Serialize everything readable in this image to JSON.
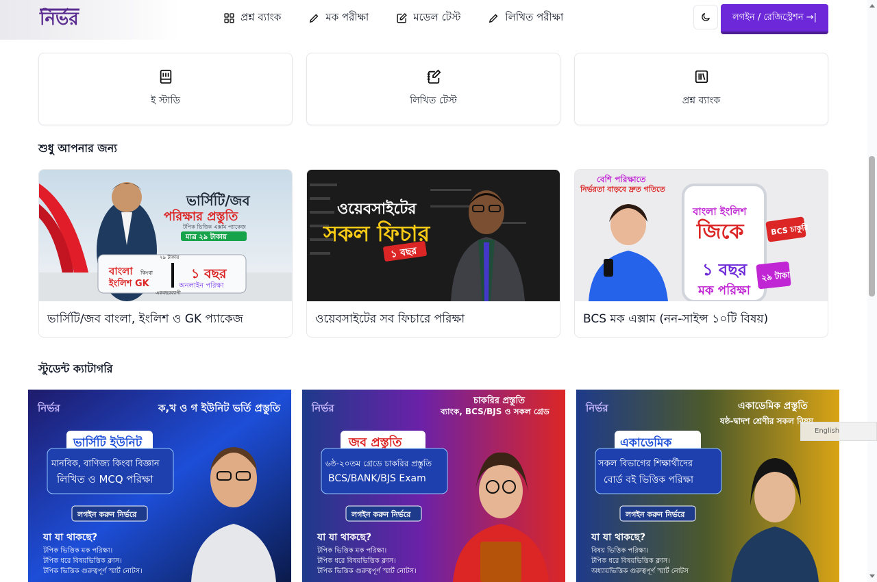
{
  "header": {
    "logo_text": "নির্ভর",
    "nav": [
      {
        "label": "প্রশ্ন ব্যাংক",
        "icon": "grid-icon"
      },
      {
        "label": "মক পরীক্ষা",
        "icon": "pencil-icon"
      },
      {
        "label": "মডেল টেস্ট",
        "icon": "edit-square-icon"
      },
      {
        "label": "লিখিত পরীক্ষা",
        "icon": "pencil-icon"
      }
    ],
    "theme_toggle_icon": "moon-icon",
    "login_label": "লগইন / রেজিস্ট্রেশন →|"
  },
  "categories": [
    {
      "label": "ই স্টাডি",
      "icon": "book-icon"
    },
    {
      "label": "লিখিত টেস্ট",
      "icon": "notebook-pen-icon"
    },
    {
      "label": "প্রশ্ন ব্যাংক",
      "icon": "library-icon"
    }
  ],
  "sections": {
    "for_you": "শুধু আপনার জন্য",
    "student_category": "স্টুডেন্ট ক্যাটাগরি"
  },
  "products": [
    {
      "title": "ভার্সিটি/জব বাংলা, ইংলিশ ও GK প্যাকেজ",
      "img_headline": "ভার্সিটি/জব",
      "img_sub": "পরিক্ষার প্রস্তুতি",
      "img_small": "টপিক ভিত্তিক এক্সাম প্যাকেজ",
      "img_price": "মাত্র ২৯ টাকায়",
      "img_box_left": "বাংলা",
      "img_box_left2": "কিংবা",
      "img_box_left3": "ইংলিশ GK",
      "img_box_right": "১ বছর",
      "img_box_right2": "অনলাইন পরিক্ষা",
      "img_price_tag": "২৯ টাকায়",
      "img_yearly": "একবছরব্যাপী"
    },
    {
      "title": "ওয়েবসাইটের সব ফিচারে পরিক্ষা",
      "img_line1": "ওয়েবসাইটের",
      "img_line2": "সকল ফিচার",
      "img_line3": "১ বছর"
    },
    {
      "title": "BCS মক এক্সাম (নন-সাইন্স ১০টি বিষয়)",
      "img_top1": "বেশি পরিক্ষাতে",
      "img_top2": "নির্ভরতা বাড়বে দ্রুত গতিতে",
      "img_phone1": "বাংলা ইংলিশ",
      "img_phone2": "জিকে",
      "img_badge": "BCS চাকুরি",
      "img_phone3": "১ বছর",
      "img_phone4": "মক পরিক্ষা",
      "img_price": "২৯ টাকা"
    }
  ],
  "students": [
    {
      "top": "ক,খ ও গ ইউনিট ভর্তি প্রস্তুতি",
      "pill": "ভার্সিটি ইউনিট",
      "box1": "মানবিক, বাণিজ্য কিংবা বিজ্ঞান",
      "box2": "লিখিত ও MCQ পরিক্ষা",
      "cta": "লগইন করুন নির্ভরে",
      "what": "যা যা থাকছে?",
      "items": [
        "টপিক ভিত্তিক মক পরিক্ষা।",
        "টপিক ধরে বিষয়ভিত্তিক ক্লাস।",
        "টপিক ভিত্তিক গুরুত্বপূর্ণ স্মার্ট নোটস।"
      ]
    },
    {
      "top": "চাকরির প্রস্তুতি",
      "top2": "ব্যাংক, BCS/BJS ও সকল গ্রেড",
      "pill": "জব প্রস্তুতি",
      "box1": "৬ষ্ঠ-২০তম গ্রেডে চাকরির প্রস্তুতি",
      "box2": "BCS/BANK/BJS Exam",
      "cta": "লগইন করুন নির্ভরে",
      "what": "যা যা থাকছে?",
      "items": [
        "টপিক ভিত্তিক মক পরিক্ষা।",
        "টপিক ধরে বিষয়ভিত্তিক ক্লাস।",
        "টপিক ভিত্তিক গুরুত্বপূর্ণ স্মার্ট নোটস।"
      ]
    },
    {
      "top": "একাডেমিক প্রস্তুতি",
      "top2": "ষষ্ঠ-দ্বাদশ শ্রেণীর সকল বিষয়",
      "pill": "একাডেমিক",
      "box1": "সকল বিভাগের শিক্ষার্থীদের",
      "box2": "বোর্ড বই ভিত্তিক পরিক্ষা",
      "cta": "লগইন করুন নির্ভরে",
      "what": "যা যা থাকছে?",
      "items": [
        "বিষয় ভিত্তিক পরিক্ষা।",
        "টপিক ধরে বিষয়ভিত্তিক ক্লাস।",
        "অধ্যায়ভিত্তিক গুরুত্বপূর্ণ স্মার্ট নোটস"
      ]
    }
  ],
  "lang_widget": "English",
  "colors": {
    "brand": "#6d28d9",
    "brand_dark": "#4c1d95"
  }
}
